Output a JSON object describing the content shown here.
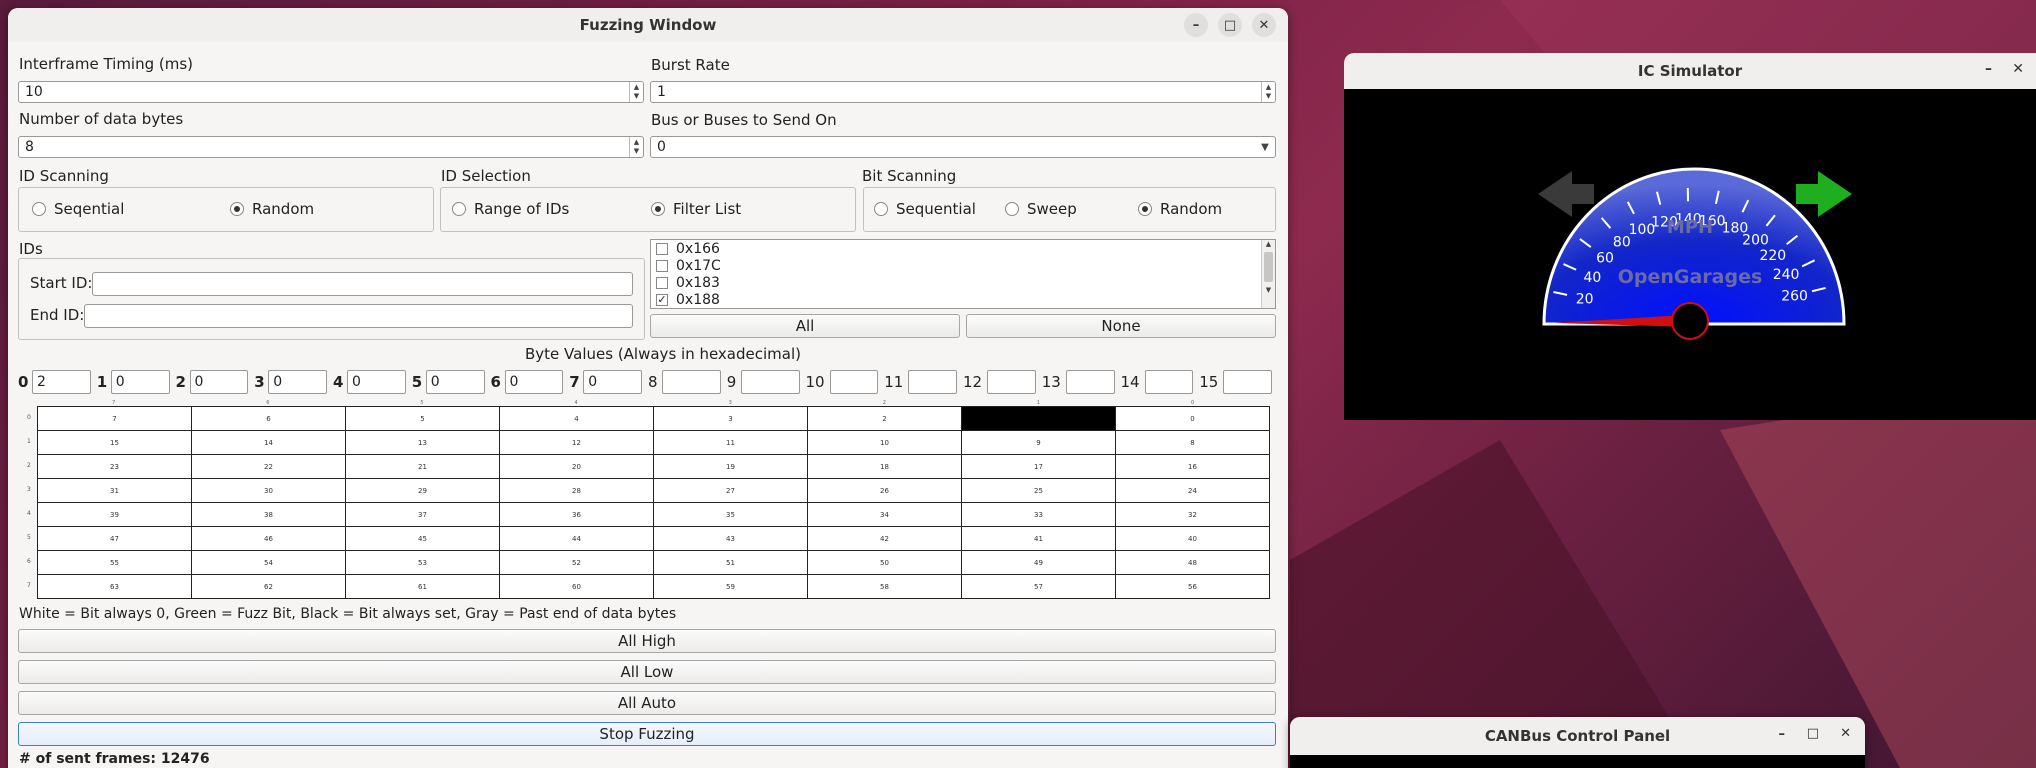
{
  "fuzzing_window": {
    "title": "Fuzzing Window",
    "interframe_label": "Interframe Timing (ms)",
    "interframe_value": "10",
    "burst_label": "Burst Rate",
    "burst_value": "1",
    "num_bytes_label": "Number of data bytes",
    "num_bytes_value": "8",
    "bus_label": "Bus or Buses to Send On",
    "bus_value": "0",
    "id_scanning": {
      "label": "ID Scanning",
      "opt1": "Seqential",
      "opt2": "Random",
      "selected": "Random"
    },
    "id_selection": {
      "label": "ID Selection",
      "opt1": "Range of IDs",
      "opt2": "Filter List",
      "selected": "Filter List"
    },
    "bit_scanning": {
      "label": "Bit Scanning",
      "opt1": "Sequential",
      "opt2": "Sweep",
      "opt3": "Random",
      "selected": "Random"
    },
    "ids_label": "IDs",
    "start_id_label": "Start ID:",
    "start_id_value": "",
    "end_id_label": "End ID:",
    "end_id_value": "",
    "id_list": [
      {
        "label": "0x166",
        "checked": false
      },
      {
        "label": "0x17C",
        "checked": false
      },
      {
        "label": "0x183",
        "checked": false
      },
      {
        "label": "0x188",
        "checked": true
      }
    ],
    "all_button": "All",
    "none_button": "None",
    "byte_values_label": "Byte Values (Always in hexadecimal)",
    "byte_values": [
      {
        "index": "0",
        "value": "2"
      },
      {
        "index": "1",
        "value": "0"
      },
      {
        "index": "2",
        "value": "0"
      },
      {
        "index": "3",
        "value": "0"
      },
      {
        "index": "4",
        "value": "0"
      },
      {
        "index": "5",
        "value": "0"
      },
      {
        "index": "6",
        "value": "0"
      },
      {
        "index": "7",
        "value": "0"
      },
      {
        "index": "8",
        "value": ""
      },
      {
        "index": "9",
        "value": ""
      },
      {
        "index": "10",
        "value": ""
      },
      {
        "index": "11",
        "value": ""
      },
      {
        "index": "12",
        "value": ""
      },
      {
        "index": "13",
        "value": ""
      },
      {
        "index": "14",
        "value": ""
      },
      {
        "index": "15",
        "value": ""
      }
    ],
    "bit_grid": {
      "col_headers": [
        "7",
        "6",
        "5",
        "4",
        "3",
        "2",
        "1",
        "0"
      ],
      "row_headers": [
        "0",
        "1",
        "2",
        "3",
        "4",
        "5",
        "6",
        "7"
      ],
      "rows": [
        [
          "7",
          "6",
          "5",
          "4",
          "3",
          "2",
          "1",
          "0"
        ],
        [
          "15",
          "14",
          "13",
          "12",
          "11",
          "10",
          "9",
          "8"
        ],
        [
          "23",
          "22",
          "21",
          "20",
          "19",
          "18",
          "17",
          "16"
        ],
        [
          "31",
          "30",
          "29",
          "28",
          "27",
          "26",
          "25",
          "24"
        ],
        [
          "39",
          "38",
          "37",
          "36",
          "35",
          "34",
          "33",
          "32"
        ],
        [
          "47",
          "46",
          "45",
          "44",
          "43",
          "42",
          "41",
          "40"
        ],
        [
          "55",
          "54",
          "53",
          "52",
          "51",
          "50",
          "49",
          "48"
        ],
        [
          "63",
          "62",
          "61",
          "60",
          "59",
          "58",
          "57",
          "56"
        ]
      ],
      "black_cells": [
        "1"
      ]
    },
    "legend": "White = Bit always 0, Green = Fuzz Bit, Black = Bit always set, Gray = Past end of data bytes",
    "all_high": "All High",
    "all_low": "All Low",
    "all_auto": "All Auto",
    "stop_fuzzing": "Stop Fuzzing",
    "sent_frames": "# of sent frames: 12476"
  },
  "ic_simulator": {
    "title": "IC Simulator",
    "speed_unit": "MPH",
    "brand": "OpenGarages",
    "speed_ticks": [
      "20",
      "40",
      "60",
      "80",
      "100",
      "120",
      "140",
      "160",
      "180",
      "200",
      "220",
      "240",
      "260"
    ],
    "left_arrow_color": "#3a3a3a",
    "right_arrow_color": "#1fae1f",
    "dial_color": "#0a1bd6"
  },
  "canbus_panel": {
    "title": "CANBus Control Panel"
  },
  "colors": {
    "window_bg": "#f6f5f4",
    "focus": "#3d7ed4",
    "wallpaper": "#7a2146"
  }
}
